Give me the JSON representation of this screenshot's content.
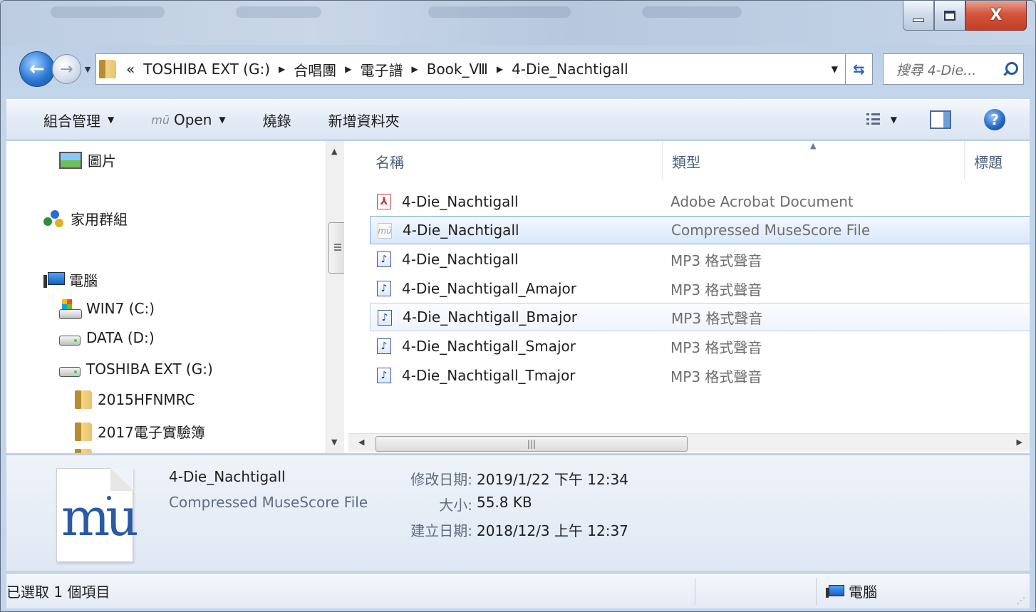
{
  "window": {
    "caption_minimize": "—",
    "caption_maximize": "□",
    "caption_close": "X"
  },
  "address_bar": {
    "chevrons": "«",
    "crumbs": [
      "TOSHIBA EXT (G:)",
      "合唱團",
      "電子譜",
      "Book_Ⅷ",
      "4-Die_Nachtigall"
    ]
  },
  "search": {
    "placeholder": "搜尋 4-Die..."
  },
  "command_bar": {
    "organize": "組合管理",
    "open": "Open",
    "burn": "燒錄",
    "new_folder": "新增資料夾"
  },
  "nav_pane": {
    "items": [
      {
        "label": "圖片",
        "icon": "pictures-icon"
      },
      {
        "label": "家用群組",
        "icon": "homegroup-icon"
      },
      {
        "label": "電腦",
        "icon": "computer-icon"
      },
      {
        "label": "WIN7 (C:)",
        "icon": "windows-drive-icon"
      },
      {
        "label": "DATA (D:)",
        "icon": "drive-icon"
      },
      {
        "label": "TOSHIBA EXT (G:)",
        "icon": "drive-icon"
      },
      {
        "label": "2015HFNMRC",
        "icon": "folder-icon"
      },
      {
        "label": "2017電子實驗簿",
        "icon": "folder-icon"
      }
    ]
  },
  "file_list": {
    "columns": [
      "名稱",
      "類型",
      "標題"
    ],
    "rows": [
      {
        "name": "4-Die_Nachtigall",
        "type": "Adobe Acrobat Document",
        "icon": "pdf-icon"
      },
      {
        "name": "4-Die_Nachtigall",
        "type": "Compressed MuseScore File",
        "icon": "musescore-icon"
      },
      {
        "name": "4-Die_Nachtigall",
        "type": "MP3 格式聲音",
        "icon": "mp3-icon"
      },
      {
        "name": "4-Die_Nachtigall_Amajor",
        "type": "MP3 格式聲音",
        "icon": "mp3-icon"
      },
      {
        "name": "4-Die_Nachtigall_Bmajor",
        "type": "MP3 格式聲音",
        "icon": "mp3-icon"
      },
      {
        "name": "4-Die_Nachtigall_Smajor",
        "type": "MP3 格式聲音",
        "icon": "mp3-icon"
      },
      {
        "name": "4-Die_Nachtigall_Tmajor",
        "type": "MP3 格式聲音",
        "icon": "mp3-icon"
      }
    ],
    "selected_index": 1,
    "hover_index": 4
  },
  "details": {
    "name": "4-Die_Nachtigall",
    "type": "Compressed MuseScore File",
    "modified_label": "修改日期:",
    "modified_value": "2019/1/22 下午 12:34",
    "size_label": "大小:",
    "size_value": "55.8 KB",
    "created_label": "建立日期:",
    "created_value": "2018/12/3 上午 12:37"
  },
  "status_bar": {
    "selection": "已選取 1 個項目",
    "location": "電腦"
  }
}
